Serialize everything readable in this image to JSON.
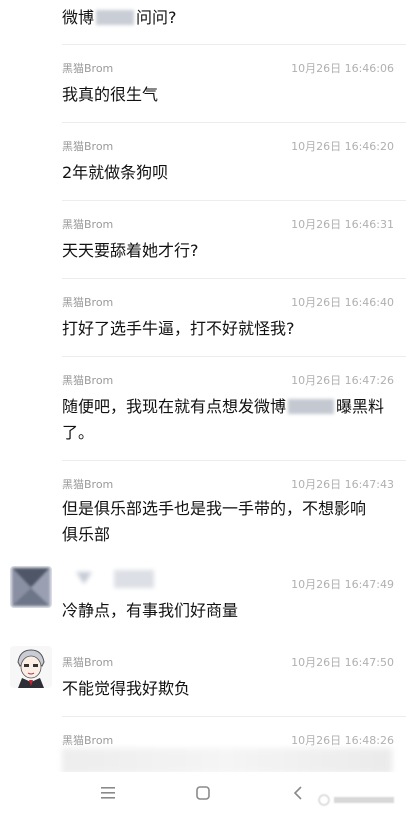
{
  "top_message": {
    "prefix": "微博",
    "suffix": "问问?"
  },
  "messages": [
    {
      "sender": "黑猫Brom",
      "time": "10月26日 16:46:06",
      "lines": [
        "我真的很生气"
      ],
      "avatar": "none"
    },
    {
      "sender": "黑猫Brom",
      "time": "10月26日 16:46:20",
      "lines": [
        "2年就做条狗呗"
      ],
      "avatar": "none"
    },
    {
      "sender": "黑猫Brom",
      "time": "10月26日 16:46:31",
      "lines": [
        "天天要舔着她才行?"
      ],
      "avatar": "none"
    },
    {
      "sender": "黑猫Brom",
      "time": "10月26日 16:46:40",
      "lines": [
        "打好了选手牛逼，打不好就怪我?"
      ],
      "avatar": "none"
    },
    {
      "sender": "黑猫Brom",
      "time": "10月26日 16:47:26",
      "lines": [
        "随便吧，我现在就有点想发微博",
        "曝黑料",
        "了。"
      ],
      "avatar": "none",
      "redacted_after_first": true
    },
    {
      "sender": "黑猫Brom",
      "time": "10月26日 16:47:43",
      "lines": [
        "但是俱乐部选手也是我一手带的，不想影响",
        "俱乐部"
      ],
      "avatar": "none"
    },
    {
      "sender": "",
      "time": "10月26日 16:47:49",
      "lines": [
        "冷静点，有事我们好商量"
      ],
      "avatar": "blurred-triangle-avatar"
    },
    {
      "sender": "黑猫Brom",
      "time": "10月26日 16:47:50",
      "lines": [
        "不能觉得我好欺负"
      ],
      "avatar": "anime-character-avatar"
    },
    {
      "sender": "黑猫Brom",
      "time": "10月26日 16:48:26",
      "lines": [],
      "avatar": "none"
    }
  ],
  "navbar": {
    "menu_icon": "menu-icon",
    "home_icon": "home-square-icon",
    "back_icon": "back-chevron-icon"
  },
  "colors": {
    "text": "#111111",
    "meta": "#9a9a9a",
    "time": "#b0b0b0"
  }
}
